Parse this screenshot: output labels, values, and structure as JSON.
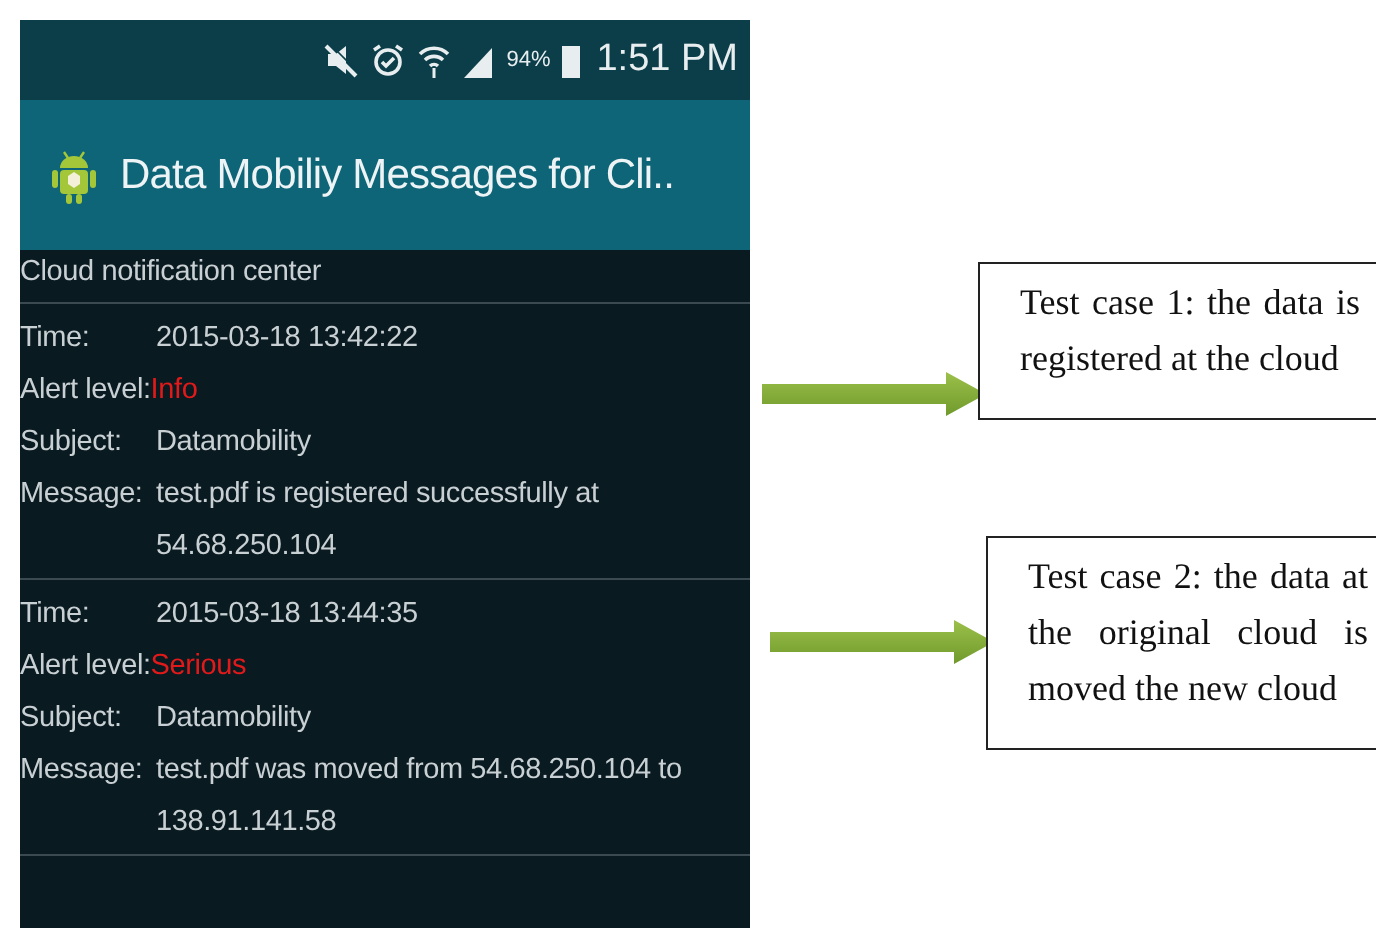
{
  "status_bar": {
    "battery": "94%",
    "time": "1:51 PM"
  },
  "app_bar": {
    "title": "Data Mobiliy Messages for Cli.."
  },
  "section_title": "Cloud notification center",
  "messages": [
    {
      "time_label": "Time:",
      "time": "2015-03-18 13:42:22",
      "alert_label": "Alert level:",
      "alert": "Info",
      "subject_label": "Subject:",
      "subject": "Datamobility",
      "message_label": "Message:",
      "message": "test.pdf is registered successfully at 54.68.250.104"
    },
    {
      "time_label": "Time:",
      "time": "2015-03-18 13:44:35",
      "alert_label": "Alert level:",
      "alert": "Serious",
      "subject_label": "Subject:",
      "subject": "Datamobility",
      "message_label": "Message:",
      "message": "test.pdf was moved from 54.68.250.104 to 138.91.141.58"
    }
  ],
  "callouts": [
    {
      "text": "Test case 1: the data is registered at the cloud"
    },
    {
      "text": "Test case 2: the data at the original cloud is moved the new cloud"
    }
  ]
}
